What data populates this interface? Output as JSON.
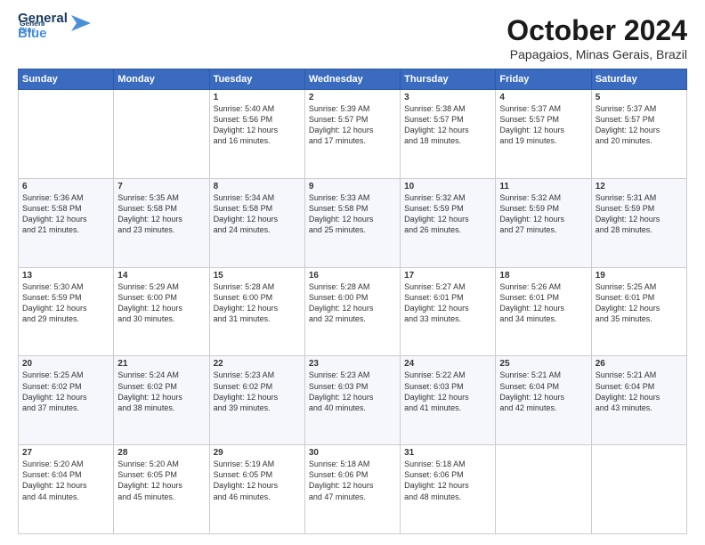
{
  "header": {
    "logo_line1": "General",
    "logo_line2": "Blue",
    "month": "October 2024",
    "location": "Papagaios, Minas Gerais, Brazil"
  },
  "days_of_week": [
    "Sunday",
    "Monday",
    "Tuesday",
    "Wednesday",
    "Thursday",
    "Friday",
    "Saturday"
  ],
  "weeks": [
    [
      {
        "day": "",
        "info": ""
      },
      {
        "day": "",
        "info": ""
      },
      {
        "day": "1",
        "info": "Sunrise: 5:40 AM\nSunset: 5:56 PM\nDaylight: 12 hours\nand 16 minutes."
      },
      {
        "day": "2",
        "info": "Sunrise: 5:39 AM\nSunset: 5:57 PM\nDaylight: 12 hours\nand 17 minutes."
      },
      {
        "day": "3",
        "info": "Sunrise: 5:38 AM\nSunset: 5:57 PM\nDaylight: 12 hours\nand 18 minutes."
      },
      {
        "day": "4",
        "info": "Sunrise: 5:37 AM\nSunset: 5:57 PM\nDaylight: 12 hours\nand 19 minutes."
      },
      {
        "day": "5",
        "info": "Sunrise: 5:37 AM\nSunset: 5:57 PM\nDaylight: 12 hours\nand 20 minutes."
      }
    ],
    [
      {
        "day": "6",
        "info": "Sunrise: 5:36 AM\nSunset: 5:58 PM\nDaylight: 12 hours\nand 21 minutes."
      },
      {
        "day": "7",
        "info": "Sunrise: 5:35 AM\nSunset: 5:58 PM\nDaylight: 12 hours\nand 23 minutes."
      },
      {
        "day": "8",
        "info": "Sunrise: 5:34 AM\nSunset: 5:58 PM\nDaylight: 12 hours\nand 24 minutes."
      },
      {
        "day": "9",
        "info": "Sunrise: 5:33 AM\nSunset: 5:58 PM\nDaylight: 12 hours\nand 25 minutes."
      },
      {
        "day": "10",
        "info": "Sunrise: 5:32 AM\nSunset: 5:59 PM\nDaylight: 12 hours\nand 26 minutes."
      },
      {
        "day": "11",
        "info": "Sunrise: 5:32 AM\nSunset: 5:59 PM\nDaylight: 12 hours\nand 27 minutes."
      },
      {
        "day": "12",
        "info": "Sunrise: 5:31 AM\nSunset: 5:59 PM\nDaylight: 12 hours\nand 28 minutes."
      }
    ],
    [
      {
        "day": "13",
        "info": "Sunrise: 5:30 AM\nSunset: 5:59 PM\nDaylight: 12 hours\nand 29 minutes."
      },
      {
        "day": "14",
        "info": "Sunrise: 5:29 AM\nSunset: 6:00 PM\nDaylight: 12 hours\nand 30 minutes."
      },
      {
        "day": "15",
        "info": "Sunrise: 5:28 AM\nSunset: 6:00 PM\nDaylight: 12 hours\nand 31 minutes."
      },
      {
        "day": "16",
        "info": "Sunrise: 5:28 AM\nSunset: 6:00 PM\nDaylight: 12 hours\nand 32 minutes."
      },
      {
        "day": "17",
        "info": "Sunrise: 5:27 AM\nSunset: 6:01 PM\nDaylight: 12 hours\nand 33 minutes."
      },
      {
        "day": "18",
        "info": "Sunrise: 5:26 AM\nSunset: 6:01 PM\nDaylight: 12 hours\nand 34 minutes."
      },
      {
        "day": "19",
        "info": "Sunrise: 5:25 AM\nSunset: 6:01 PM\nDaylight: 12 hours\nand 35 minutes."
      }
    ],
    [
      {
        "day": "20",
        "info": "Sunrise: 5:25 AM\nSunset: 6:02 PM\nDaylight: 12 hours\nand 37 minutes."
      },
      {
        "day": "21",
        "info": "Sunrise: 5:24 AM\nSunset: 6:02 PM\nDaylight: 12 hours\nand 38 minutes."
      },
      {
        "day": "22",
        "info": "Sunrise: 5:23 AM\nSunset: 6:02 PM\nDaylight: 12 hours\nand 39 minutes."
      },
      {
        "day": "23",
        "info": "Sunrise: 5:23 AM\nSunset: 6:03 PM\nDaylight: 12 hours\nand 40 minutes."
      },
      {
        "day": "24",
        "info": "Sunrise: 5:22 AM\nSunset: 6:03 PM\nDaylight: 12 hours\nand 41 minutes."
      },
      {
        "day": "25",
        "info": "Sunrise: 5:21 AM\nSunset: 6:04 PM\nDaylight: 12 hours\nand 42 minutes."
      },
      {
        "day": "26",
        "info": "Sunrise: 5:21 AM\nSunset: 6:04 PM\nDaylight: 12 hours\nand 43 minutes."
      }
    ],
    [
      {
        "day": "27",
        "info": "Sunrise: 5:20 AM\nSunset: 6:04 PM\nDaylight: 12 hours\nand 44 minutes."
      },
      {
        "day": "28",
        "info": "Sunrise: 5:20 AM\nSunset: 6:05 PM\nDaylight: 12 hours\nand 45 minutes."
      },
      {
        "day": "29",
        "info": "Sunrise: 5:19 AM\nSunset: 6:05 PM\nDaylight: 12 hours\nand 46 minutes."
      },
      {
        "day": "30",
        "info": "Sunrise: 5:18 AM\nSunset: 6:06 PM\nDaylight: 12 hours\nand 47 minutes."
      },
      {
        "day": "31",
        "info": "Sunrise: 5:18 AM\nSunset: 6:06 PM\nDaylight: 12 hours\nand 48 minutes."
      },
      {
        "day": "",
        "info": ""
      },
      {
        "day": "",
        "info": ""
      }
    ]
  ]
}
